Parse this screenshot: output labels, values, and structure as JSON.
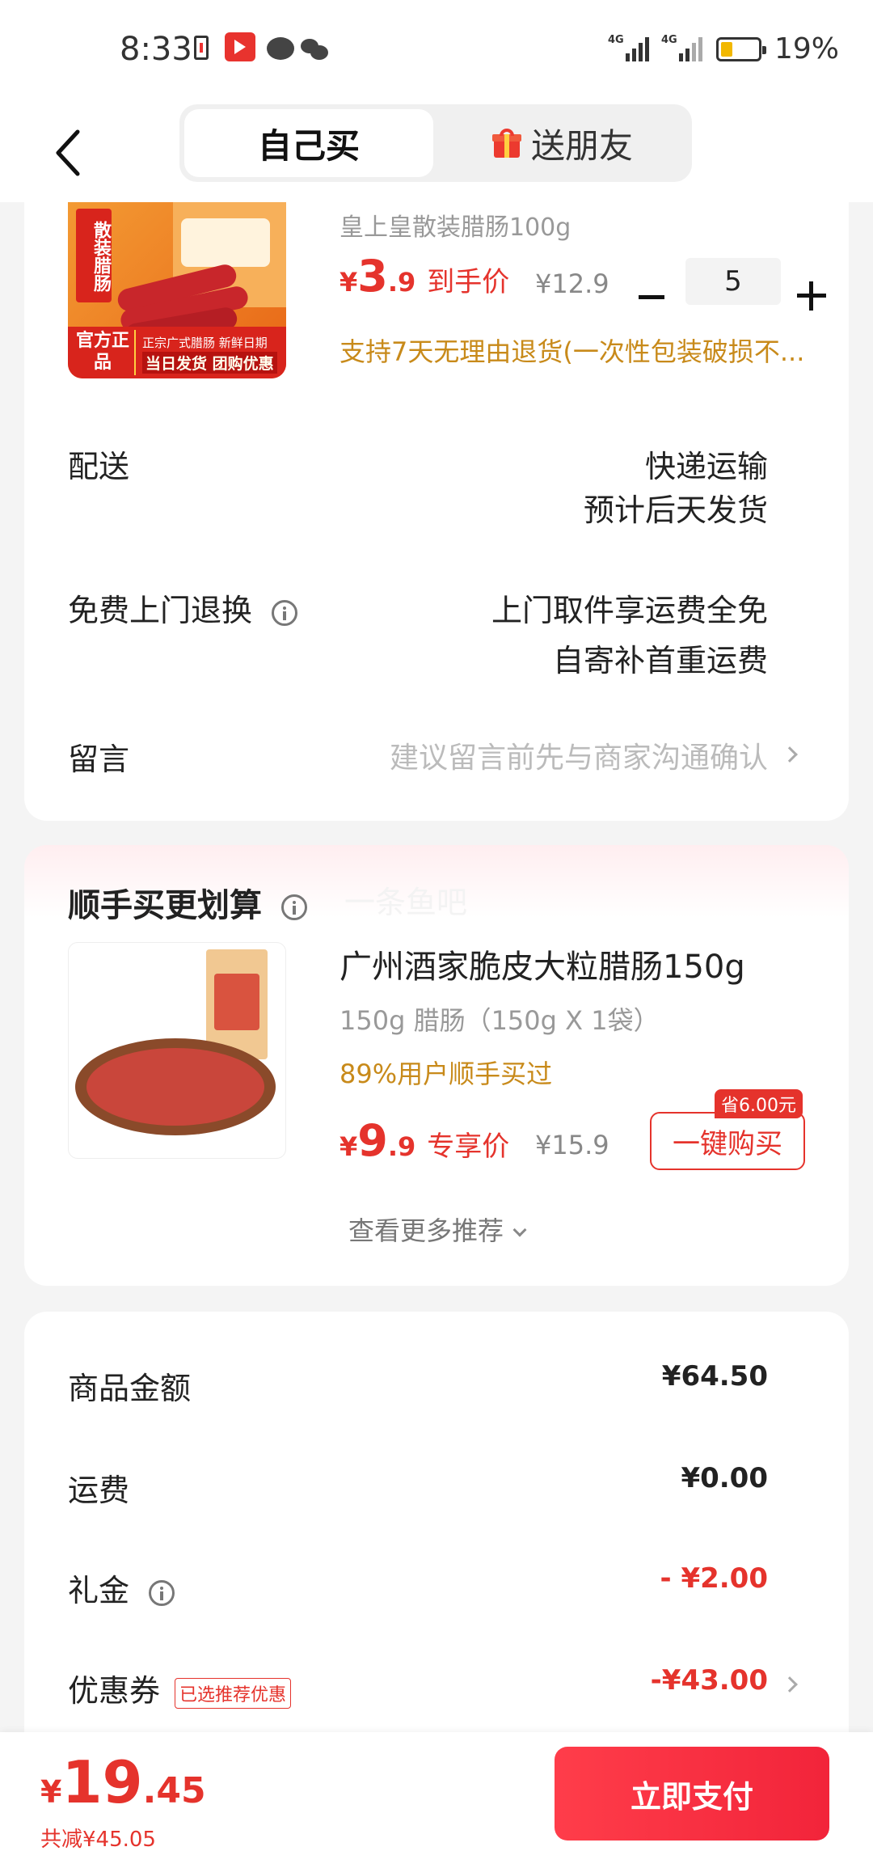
{
  "status_bar": {
    "time": "8:33",
    "signal1": "4G",
    "signal2": "4G",
    "battery": "19%",
    "battery_level": 0.19
  },
  "header": {
    "tab_self": "自己买",
    "tab_gift": "送朋友"
  },
  "product": {
    "name": "皇上皇散装腊肠100g",
    "price_int": "3",
    "price_dec": ".9",
    "price_label": "到手价",
    "original_price": "¥12.9",
    "quantity": "5",
    "return_policy": "支持7天无理由退货(一次性包装破损不...",
    "image_badge_text": "散装腊肠",
    "image_official": "官方正品",
    "image_line1": "正宗广式腊肠 新鲜日期",
    "image_line2": "当日发货 团购优惠"
  },
  "currency": "¥",
  "delivery": {
    "label": "配送",
    "method": "快递运输",
    "eta": "预计后天发货"
  },
  "return_service": {
    "label": "免费上门退换",
    "line1": "上门取件享运费全免",
    "line2": "自寄补首重运费"
  },
  "message": {
    "label": "留言",
    "placeholder": "建议留言前先与商家沟通确认"
  },
  "addon": {
    "title": "顺手买更划算",
    "ghost_text": "一条鱼吧",
    "name": "广州酒家脆皮大粒腊肠150g",
    "spec": "150g 腊肠（150g X 1袋）",
    "social": "89%用户顺手买过",
    "price_int": "9",
    "price_dec": ".9",
    "price_label": "专享价",
    "original_price": "¥15.9",
    "save_badge": "省6.00元",
    "buy_button": "一键购买",
    "more": "查看更多推荐"
  },
  "fees": {
    "goods_label": "商品金额",
    "goods_value": "¥64.50",
    "shipping_label": "运费",
    "shipping_value": "¥0.00",
    "gift_label": "礼金",
    "gift_value": "- ¥2.00",
    "coupon_label": "优惠券",
    "coupon_tag": "已选推荐优惠",
    "coupon_value": "-¥43.00"
  },
  "footer": {
    "total_int": "19",
    "total_dec": ".45",
    "saved": "共减¥45.05",
    "pay_button": "立即支付"
  },
  "colors": {
    "accent_red": "#e5332c",
    "gold_text": "#c88a1a"
  }
}
